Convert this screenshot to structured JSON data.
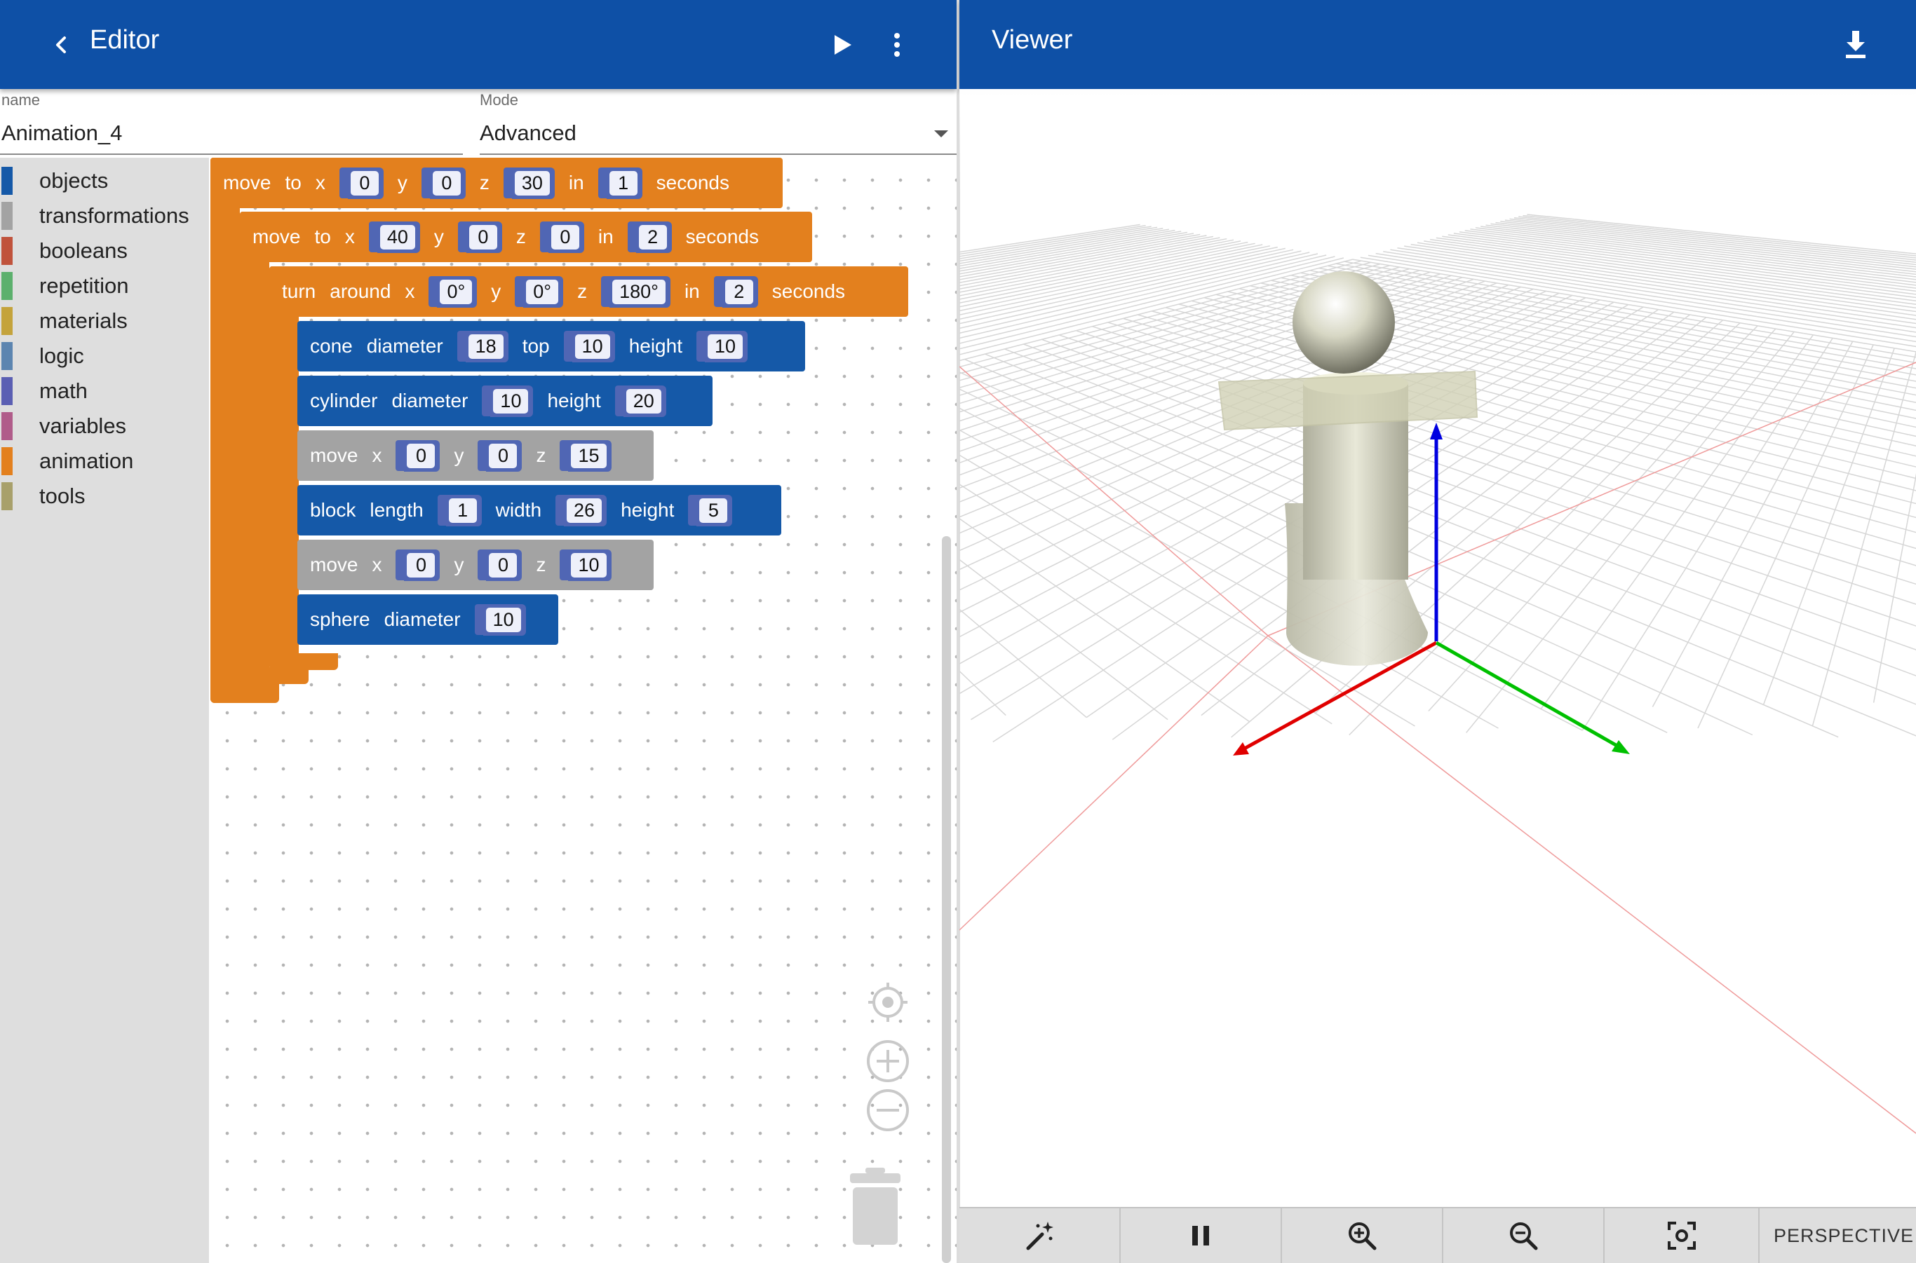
{
  "editor": {
    "title": "Editor",
    "name_label": "name",
    "name_value": "Animation_4",
    "mode_label": "Mode",
    "mode_value": "Advanced"
  },
  "viewer": {
    "title": "Viewer",
    "camera_mode": "PERSPECTIVE"
  },
  "toolbox": {
    "categories": [
      {
        "label": "objects",
        "color": "#1559a8"
      },
      {
        "label": "transformations",
        "color": "#a3a3a3"
      },
      {
        "label": "booleans",
        "color": "#c0533c"
      },
      {
        "label": "repetition",
        "color": "#5cb06d"
      },
      {
        "label": "materials",
        "color": "#c4a33c"
      },
      {
        "label": "logic",
        "color": "#5c85b0"
      },
      {
        "label": "math",
        "color": "#5b5fb3"
      },
      {
        "label": "variables",
        "color": "#b05c8a"
      },
      {
        "label": "animation",
        "color": "#e3801e"
      },
      {
        "label": "tools",
        "color": "#a8a06b"
      }
    ]
  },
  "blocks": {
    "move1": {
      "w1": "move",
      "w2": "to",
      "w3": "x",
      "x": "0",
      "w4": "y",
      "y": "0",
      "w5": "z",
      "z": "30",
      "w6": "in",
      "t": "1",
      "w7": "seconds"
    },
    "move2": {
      "w1": "move",
      "w2": "to",
      "w3": "x",
      "x": "40",
      "w4": "y",
      "y": "0",
      "w5": "z",
      "z": "0",
      "w6": "in",
      "t": "2",
      "w7": "seconds"
    },
    "turn": {
      "w1": "turn",
      "w2": "around",
      "w3": "x",
      "x": "0°",
      "w4": "y",
      "y": "0°",
      "w5": "z",
      "z": "180°",
      "w6": "in",
      "t": "2",
      "w7": "seconds"
    },
    "cone": {
      "w1": "cone",
      "w2": "diameter",
      "d": "18",
      "w3": "top",
      "top": "10",
      "w4": "height",
      "h": "10"
    },
    "cylinder": {
      "w1": "cylinder",
      "w2": "diameter",
      "d": "10",
      "w3": "height",
      "h": "20"
    },
    "move3": {
      "w1": "move",
      "w2": "x",
      "x": "0",
      "w3": "y",
      "y": "0",
      "w4": "z",
      "z": "15"
    },
    "block": {
      "w1": "block",
      "w2": "length",
      "l": "1",
      "w3": "width",
      "wv": "26",
      "w4": "height",
      "h": "5"
    },
    "move4": {
      "w1": "move",
      "w2": "x",
      "x": "0",
      "w3": "y",
      "y": "0",
      "w4": "z",
      "z": "10"
    },
    "sphere": {
      "w1": "sphere",
      "w2": "diameter",
      "d": "10"
    }
  },
  "colors": {
    "app_bar": "#0e50a6",
    "animation_block": "#e3801e",
    "object_block": "#1559a8",
    "transform_block": "#a3a3a3",
    "value_block": "#5066b4",
    "axis_x": "#e00000",
    "axis_y": "#00c000",
    "axis_z": "#0000e0"
  },
  "icons": {
    "back": "chevron-left-icon",
    "run": "play-icon",
    "more": "more-vertical-icon",
    "download": "download-icon",
    "recenter": "target-icon",
    "zoom_in_ws": "plus-circle-icon",
    "zoom_out_ws": "minus-circle-icon",
    "trash": "trash-icon",
    "magic": "magic-wand-icon",
    "pause": "pause-icon",
    "zoom_in": "zoom-in-icon",
    "zoom_out": "zoom-out-icon",
    "fit": "fit-view-icon",
    "dropdown": "caret-down-icon"
  }
}
